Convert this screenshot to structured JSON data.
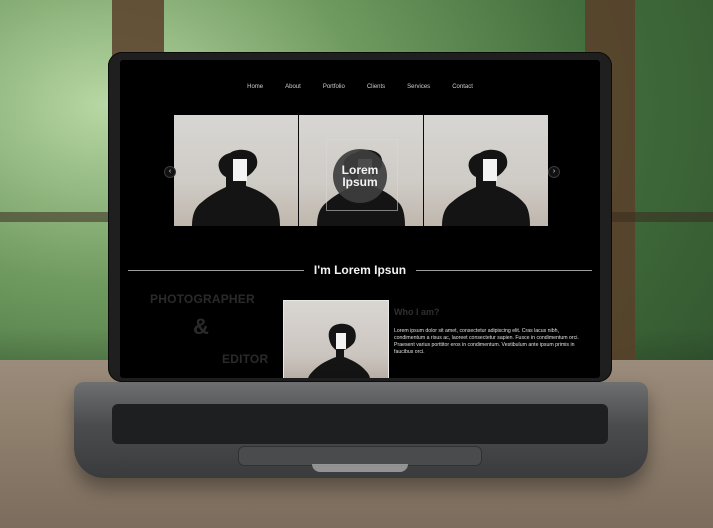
{
  "site": {
    "nav": [
      "Home",
      "About",
      "Portfolio",
      "Clients",
      "Services",
      "Contact"
    ],
    "hero_overlay": [
      "Lorem",
      "Ipsum"
    ],
    "section_title": "I'm Lorem Ipsun",
    "roles": [
      "PHOTOGRAPHER",
      "&",
      "EDITOR"
    ],
    "who_title": "Who I am?",
    "about_text": "Lorem ipsum dolor sit amet, consectetur adipiscing elit. Cras lacus nibh, condimentum a risus ac, laoreet consectetur sapien. Fusce in condimentum orci. Praesent varius porttitor eros in condimentum. Vestibulum ante ipsum primis in faucibus orci."
  },
  "icons": {
    "carousel_left": "chevron-left-icon",
    "carousel_right": "chevron-right-icon"
  },
  "colors": {
    "screen_bg": "#000000",
    "text": "#e0e0e0",
    "muted": "#2a2a2a"
  }
}
